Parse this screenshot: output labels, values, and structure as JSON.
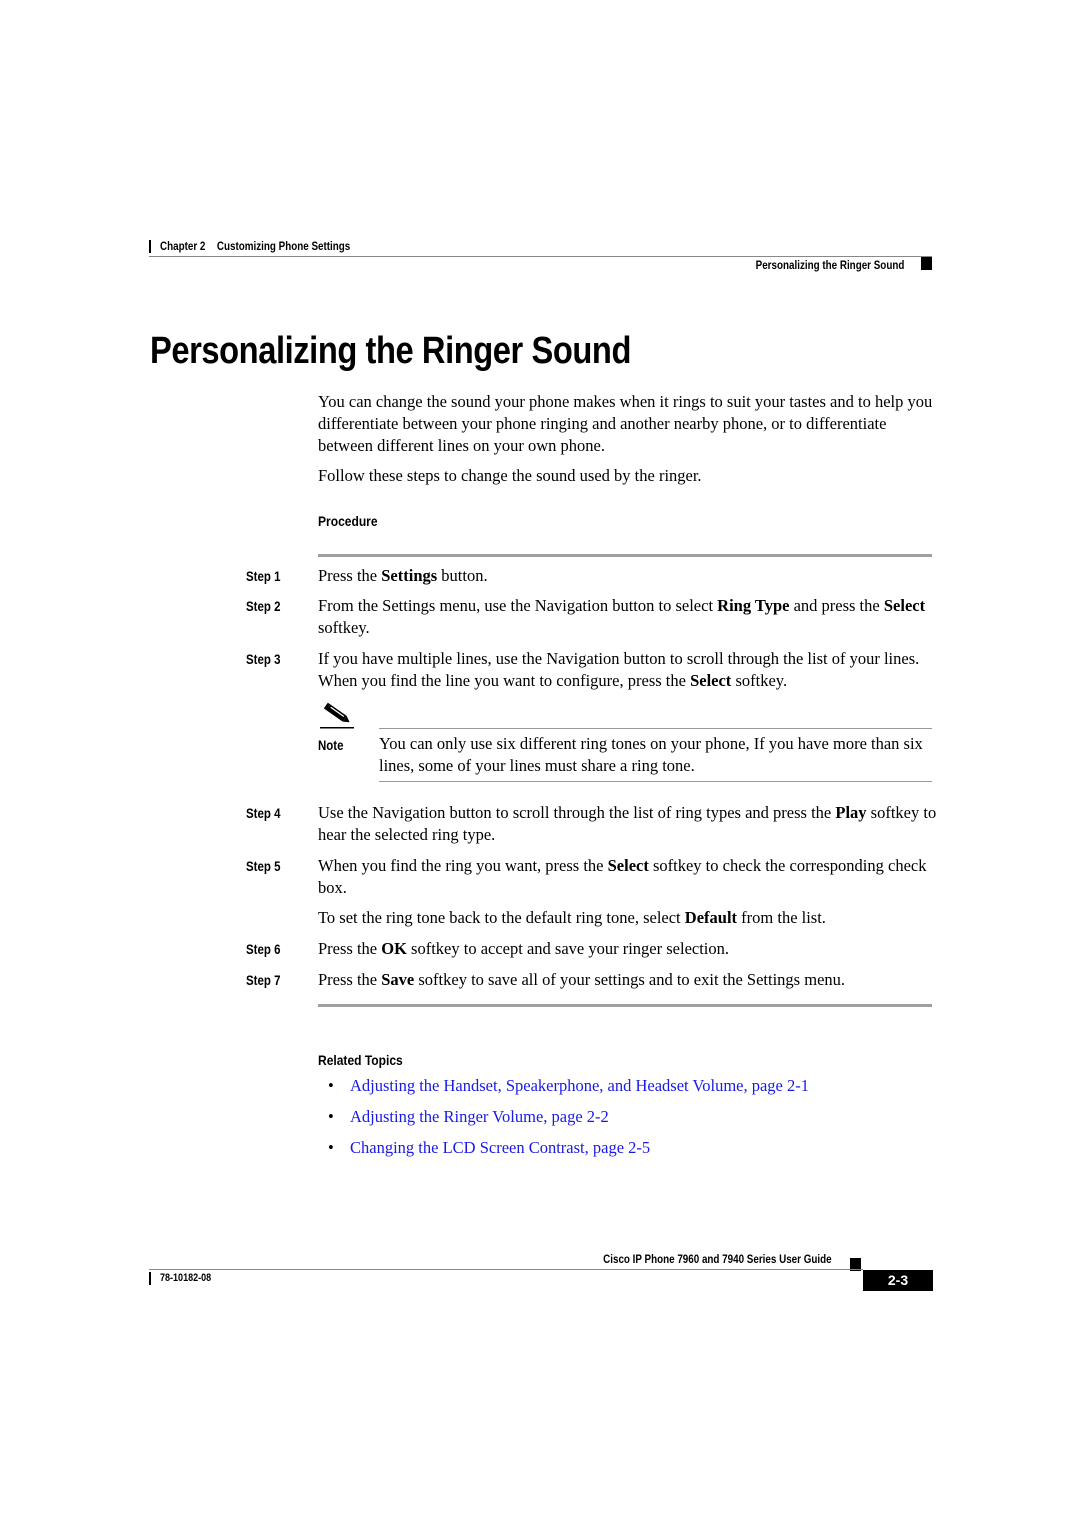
{
  "header": {
    "chapter_label": "Chapter 2",
    "chapter_title": "Customizing Phone Settings",
    "section_title": "Personalizing the Ringer Sound"
  },
  "page_title": "Personalizing the Ringer Sound",
  "intro": {
    "paragraph1": "You can change the sound your phone makes when it rings to suit your tastes and to help you differentiate between your phone ringing and another nearby phone, or to differentiate between different lines on your own phone.",
    "paragraph2": "Follow these steps to change the sound used by the ringer."
  },
  "procedure": {
    "heading": "Procedure",
    "steps": [
      {
        "label": "Step 1",
        "parts": [
          "Press the ",
          "Settings",
          " button."
        ]
      },
      {
        "label": "Step 2",
        "parts": [
          "From the Settings menu, use the Navigation button to select ",
          "Ring Type",
          " and press the ",
          "Select",
          " softkey."
        ]
      },
      {
        "label": "Step 3",
        "parts": [
          "If you have multiple lines, use the Navigation button to scroll through the list of your lines. When you find the line you want to configure, press the ",
          "Select",
          " softkey."
        ]
      },
      {
        "label": "Step 4",
        "parts": [
          "Use the Navigation button to scroll through the list of ring types and press the ",
          "Play",
          " softkey to hear the selected ring type."
        ]
      },
      {
        "label": "Step 5",
        "parts": [
          "When you find the ring you want, press the ",
          "Select",
          " softkey to check the corresponding check box."
        ]
      },
      {
        "label": "",
        "parts": [
          "To set the ring tone back to the default ring tone, select ",
          "Default",
          " from the list."
        ]
      },
      {
        "label": "Step 6",
        "parts": [
          "Press the ",
          "OK",
          " softkey to accept and save your ringer selection."
        ]
      },
      {
        "label": "Step 7",
        "parts": [
          "Press the ",
          "Save",
          " softkey to save all of your settings and to exit the Settings menu."
        ]
      }
    ],
    "note": {
      "icon": "pencil-note-icon",
      "label": "Note",
      "text": "You can only use six different ring tones on your phone, If you have more than six lines, some of your lines must share a ring tone."
    }
  },
  "related_topics": {
    "heading": "Related Topics",
    "links": [
      "Adjusting the Handset, Speakerphone, and Headset Volume, page 2-1",
      "Adjusting the Ringer Volume, page 2-2",
      "Changing the LCD Screen Contrast, page 2-5"
    ],
    "link_color": "#1a1ae6"
  },
  "footer": {
    "guide_title": "Cisco IP Phone 7960 and 7940 Series User Guide",
    "doc_number": "78-10182-08",
    "page_number": "2-3"
  }
}
